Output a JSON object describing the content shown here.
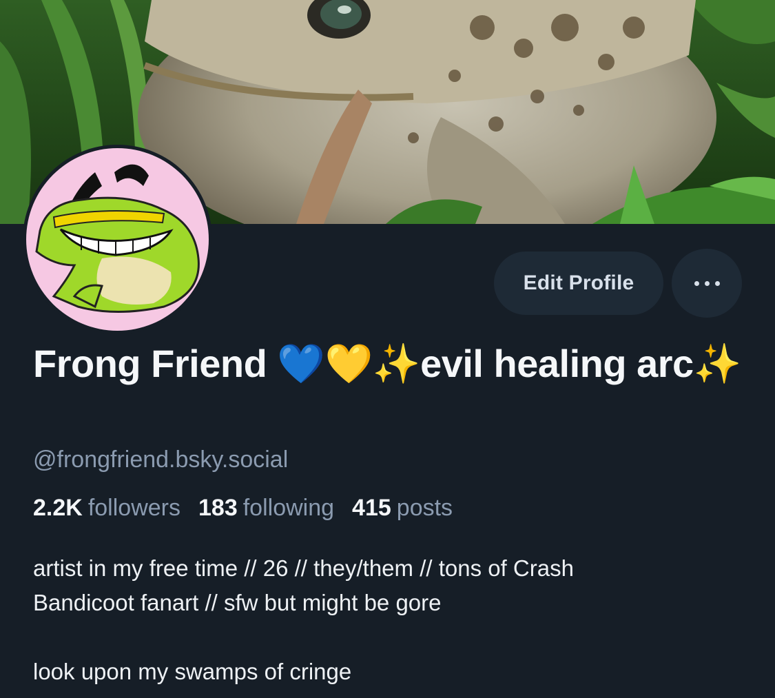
{
  "profile": {
    "display_name_text": "Frong Friend",
    "display_name_emojis": [
      "💙",
      "💛",
      "✨"
    ],
    "display_name_suffix": "evil healing arc",
    "display_name_end_emoji": "✨",
    "handle": "@frongfriend.bsky.social",
    "followers_count": "2.2K",
    "followers_label": "followers",
    "following_count": "183",
    "following_label": "following",
    "posts_count": "415",
    "posts_label": "posts",
    "bio": "artist in my free time // 26 // they/them // tons of Crash\nBandicoot fanart // sfw but might be gore\n\nlook upon my swamps of cringe"
  },
  "actions": {
    "edit_profile_label": "Edit Profile",
    "more_icon": "ellipsis-icon"
  },
  "colors": {
    "background": "#161e27",
    "button_bg": "#1e2a36",
    "muted_text": "#8b9bb0",
    "avatar_bg": "#f6c8e3"
  }
}
